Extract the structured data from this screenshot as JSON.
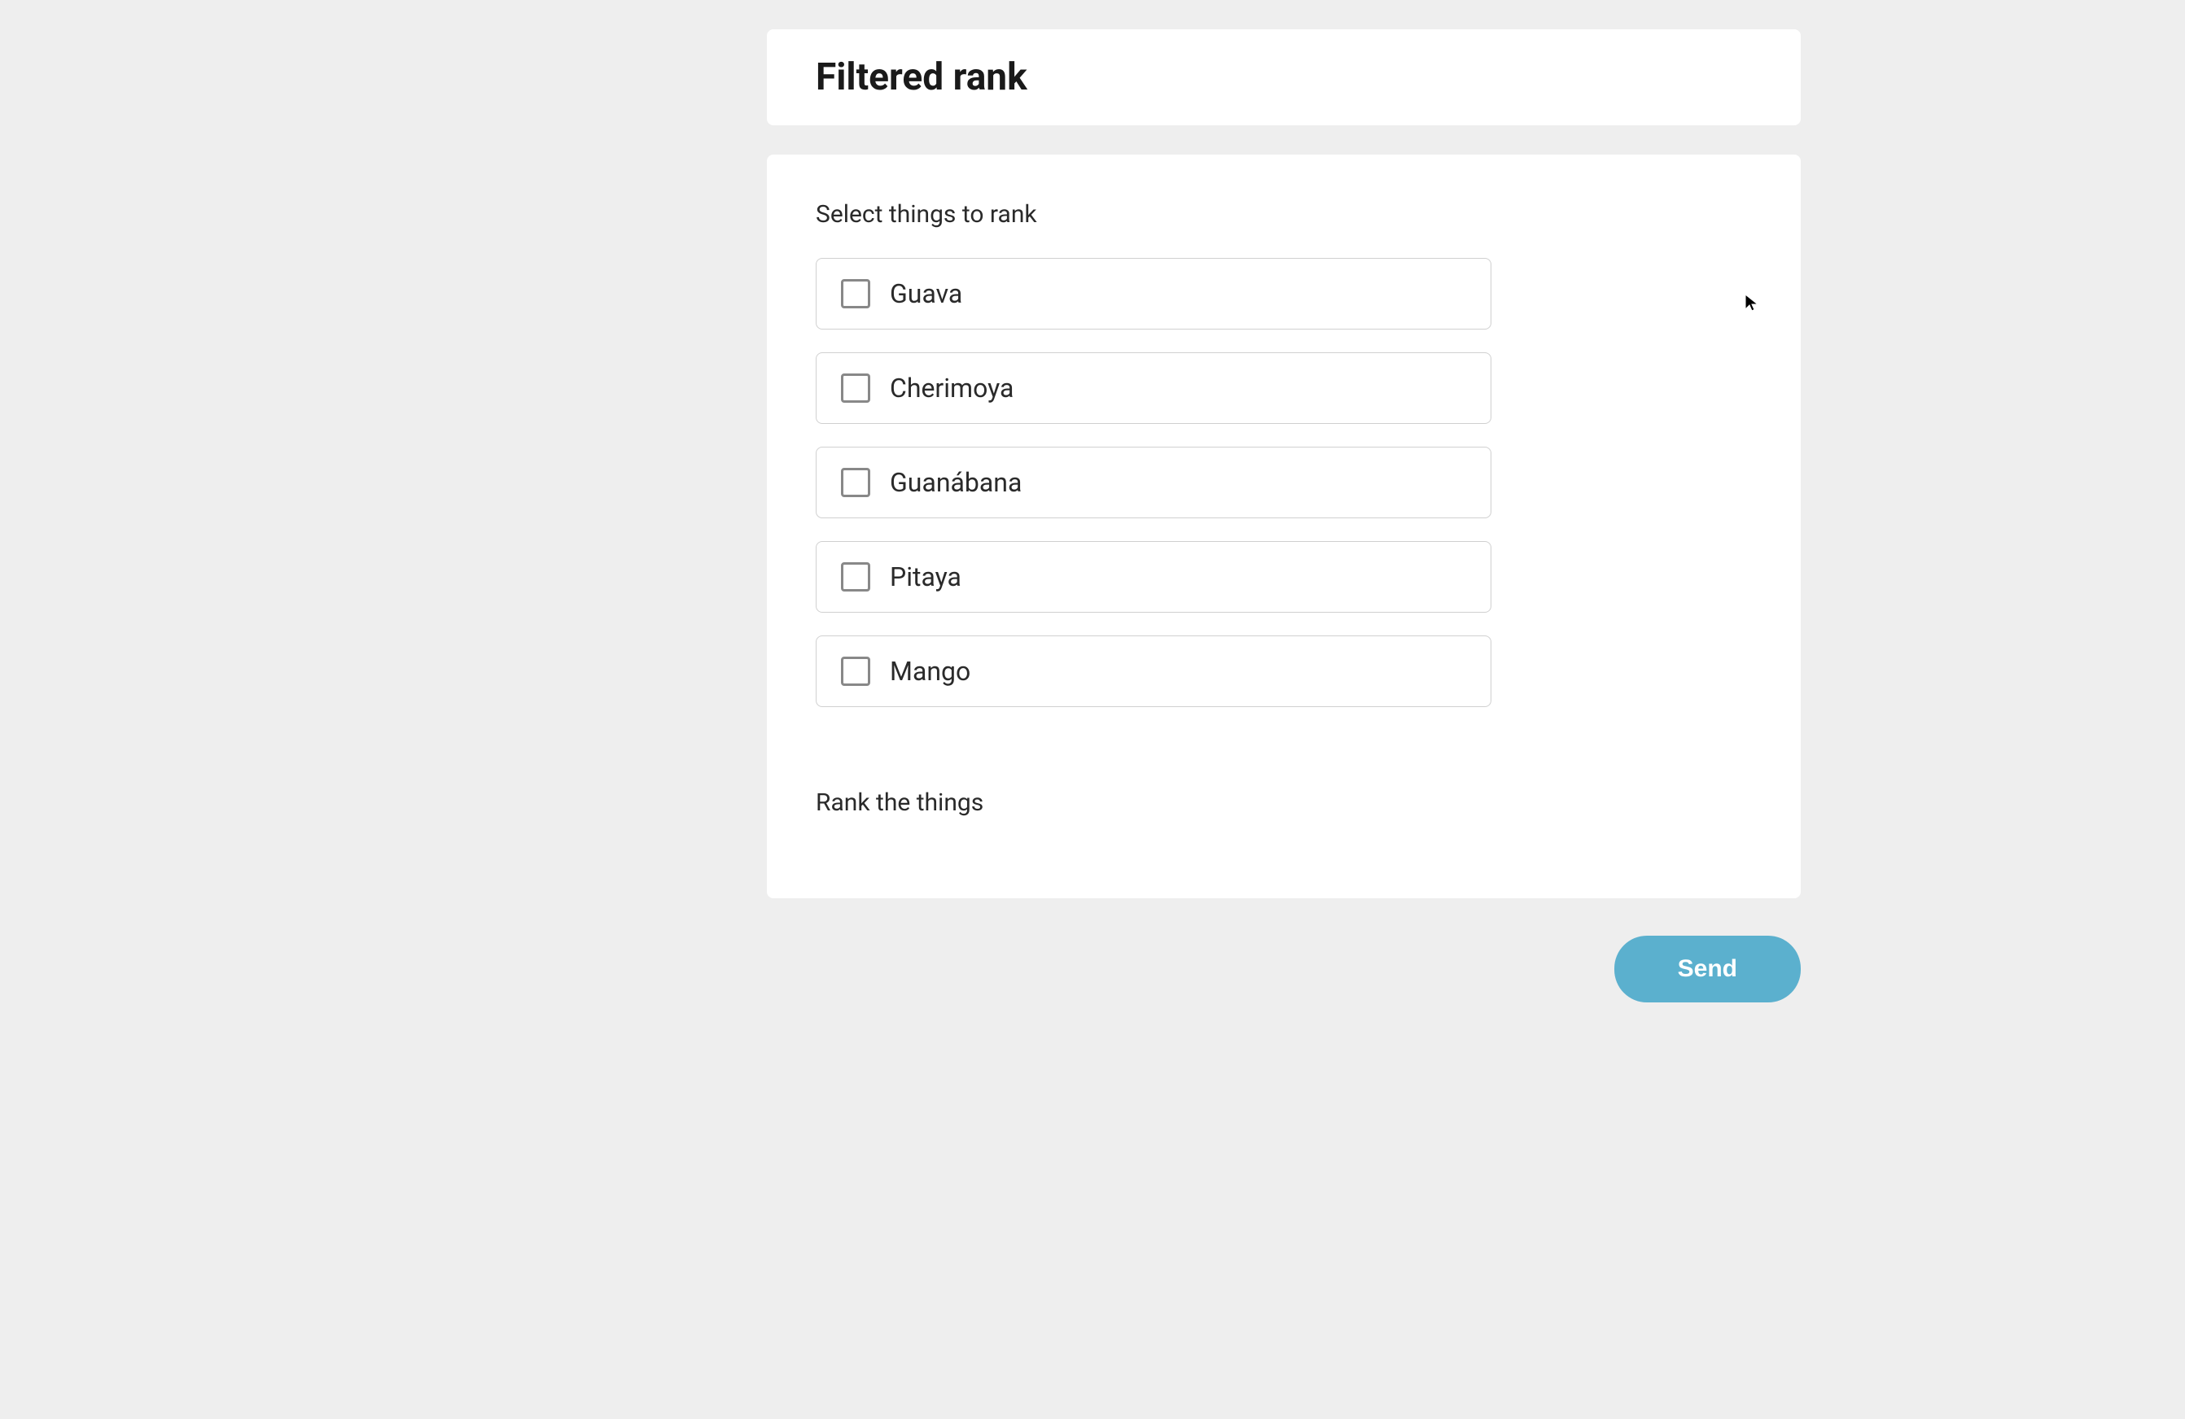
{
  "header": {
    "title": "Filtered rank"
  },
  "content": {
    "select_section_label": "Select things to rank",
    "rank_section_label": "Rank the things",
    "items": [
      {
        "label": "Guava",
        "checked": false
      },
      {
        "label": "Cherimoya",
        "checked": false
      },
      {
        "label": "Guanábana",
        "checked": false
      },
      {
        "label": "Pitaya",
        "checked": false
      },
      {
        "label": "Mango",
        "checked": false
      }
    ]
  },
  "actions": {
    "send_label": "Send"
  }
}
